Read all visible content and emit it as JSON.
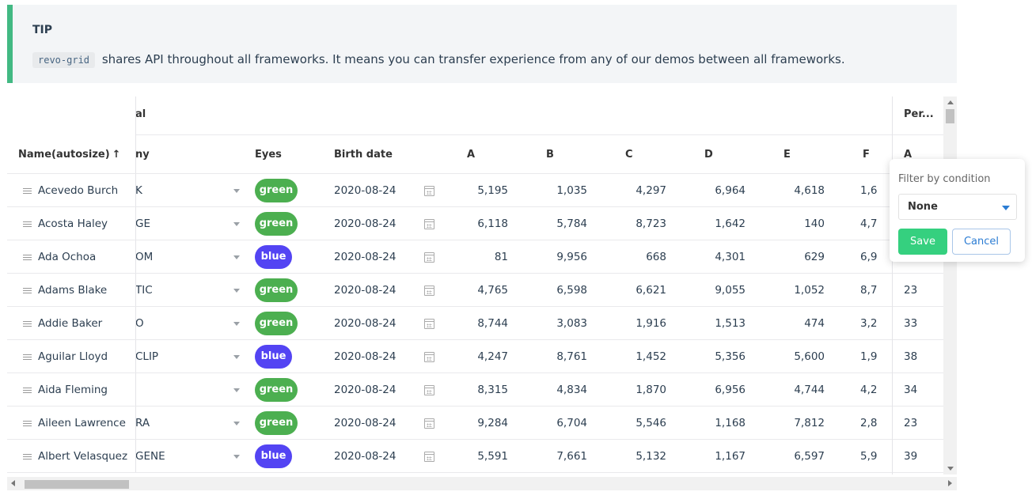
{
  "tip": {
    "title": "TIP",
    "code": "revo-grid",
    "text": "shares API throughout all frameworks. It means you can transfer experience from any of our demos between all frameworks."
  },
  "grid": {
    "group_headers": {
      "general_partial": "al",
      "personal_partial": "Per..."
    },
    "columns": {
      "name": "Name(autosize)",
      "sort_indicator": "↑",
      "company_partial": "ny",
      "eyes": "Eyes",
      "birth": "Birth date",
      "a": "A",
      "b": "B",
      "c": "C",
      "d": "D",
      "e": "E",
      "f": "F",
      "personal_a": "A"
    },
    "rows": [
      {
        "name": "Acevedo Burch",
        "company": "K",
        "eyes": "green",
        "birth": "2020-08-24",
        "a": "5,195",
        "b": "1,035",
        "c": "4,297",
        "d": "6,964",
        "e": "4,618",
        "f": "1,6",
        "pa": ""
      },
      {
        "name": "Acosta Haley",
        "company": "GE",
        "eyes": "green",
        "birth": "2020-08-24",
        "a": "6,118",
        "b": "5,784",
        "c": "8,723",
        "d": "1,642",
        "e": "140",
        "f": "4,7",
        "pa": ""
      },
      {
        "name": "Ada Ochoa",
        "company": "OM",
        "eyes": "blue",
        "birth": "2020-08-24",
        "a": "81",
        "b": "9,956",
        "c": "668",
        "d": "4,301",
        "e": "629",
        "f": "6,9",
        "pa": ""
      },
      {
        "name": "Adams Blake",
        "company": "TIC",
        "eyes": "green",
        "birth": "2020-08-24",
        "a": "4,765",
        "b": "6,598",
        "c": "6,621",
        "d": "9,055",
        "e": "1,052",
        "f": "8,7",
        "pa": "23"
      },
      {
        "name": "Addie Baker",
        "company": "O",
        "eyes": "green",
        "birth": "2020-08-24",
        "a": "8,744",
        "b": "3,083",
        "c": "1,916",
        "d": "1,513",
        "e": "474",
        "f": "3,2",
        "pa": "33"
      },
      {
        "name": "Aguilar Lloyd",
        "company": "CLIP",
        "eyes": "blue",
        "birth": "2020-08-24",
        "a": "4,247",
        "b": "8,761",
        "c": "1,452",
        "d": "5,356",
        "e": "5,600",
        "f": "1,9",
        "pa": "38"
      },
      {
        "name": "Aida Fleming",
        "company": "",
        "eyes": "green",
        "birth": "2020-08-24",
        "a": "8,315",
        "b": "4,834",
        "c": "1,870",
        "d": "6,956",
        "e": "4,744",
        "f": "4,2",
        "pa": "34"
      },
      {
        "name": "Aileen Lawrence",
        "company": "RA",
        "eyes": "green",
        "birth": "2020-08-24",
        "a": "9,284",
        "b": "6,704",
        "c": "5,546",
        "d": "1,168",
        "e": "7,812",
        "f": "2,8",
        "pa": "23"
      },
      {
        "name": "Albert Velasquez",
        "company": "GENE",
        "eyes": "blue",
        "birth": "2020-08-24",
        "a": "5,591",
        "b": "7,661",
        "c": "5,132",
        "d": "1,167",
        "e": "6,597",
        "f": "5,9",
        "pa": "39"
      }
    ]
  },
  "filter": {
    "title": "Filter by condition",
    "selected": "None",
    "save_label": "Save",
    "cancel_label": "Cancel"
  },
  "colors": {
    "tip_border": "#42b983",
    "eyes_green": "#4caf50",
    "eyes_blue": "#5344f3",
    "save_button": "#35d07f",
    "cancel_text": "#2b7cd3"
  }
}
